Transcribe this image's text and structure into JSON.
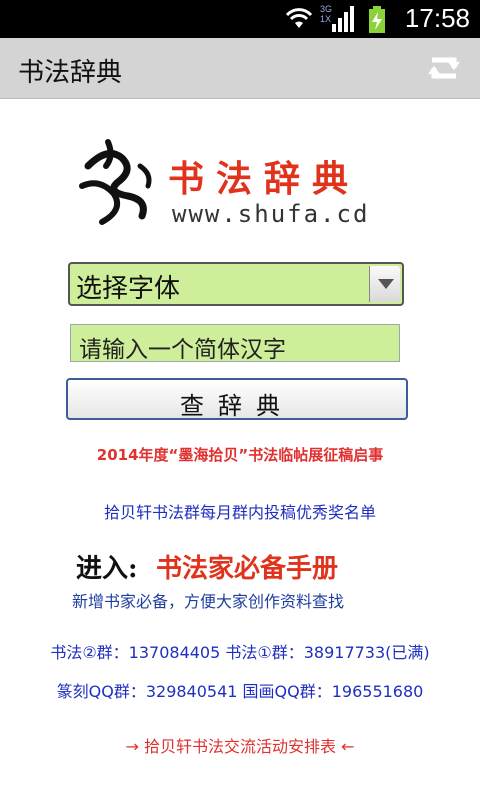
{
  "status_bar": {
    "time": "17:58",
    "network_label_top": "3G",
    "network_label_bottom": "1X",
    "icons": [
      "wifi-icon",
      "signal-icon",
      "battery-charging-icon"
    ]
  },
  "action_bar": {
    "title": "书法辞典",
    "refresh_icon": "refresh-icon"
  },
  "logo": {
    "brand_text": "书法辞典",
    "url_text": "www.shufa.cd",
    "brand_color": "#e0331c"
  },
  "form": {
    "font_select": {
      "selected": "选择字体"
    },
    "char_input": {
      "placeholder": "请输入一个简体汉字"
    },
    "search_button": {
      "label": "查辞典"
    }
  },
  "links": {
    "contest": "2014年度“墨海拾贝”书法临帖展征稿启事",
    "monthly_awards": "拾贝轩书法群每月群内投稿优秀奖名单",
    "banner_prefix": "进入:",
    "banner_title": "书法家必备手册",
    "banner_sub": "新增书家必备，方便大家创作资料查找",
    "qq_line1": "书法②群：137084405  书法①群：38917733(已满)",
    "qq_line2": "篆刻QQ群：329840541  国画QQ群：196551680",
    "schedule": "→ 拾贝轩书法交流活动安排表 ←"
  },
  "colors": {
    "input_bg": "#cfee9a",
    "link_blue": "#1f2fbf",
    "link_red": "#e03030",
    "action_bar_bg": "#d4d4d4"
  }
}
